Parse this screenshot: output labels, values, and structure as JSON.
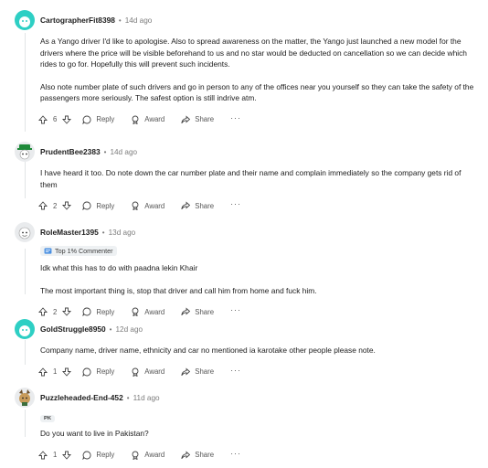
{
  "comments": [
    {
      "author": "CartographerFit8398",
      "time": "14d ago",
      "avatar_color": "#2ecfc4",
      "paragraphs": [
        "As a Yango driver I'd like to apologise. Also to spread awareness on the matter, the Yango just launched a new model for the drivers where the price will be visible beforehand to us and no star would be deducted on cancellation so we can decide which rides to go for. Hopefully this will prevent such incidents.",
        "Also note number plate of such drivers and go in person to any of the offices near you yourself so they can take the safety of the passengers more seriously. The safest option is still indrive atm."
      ],
      "votes": "6"
    },
    {
      "author": "PrudentBee2383",
      "time": "14d ago",
      "avatar_color": "#e9ebed",
      "paragraphs": [
        "I have heard it too. Do note down the car number plate and their name and complain immediately so the company gets rid of them"
      ],
      "votes": "2"
    },
    {
      "author": "RoleMaster1395",
      "time": "13d ago",
      "avatar_color": "#e9ebed",
      "flair": "Top 1% Commenter",
      "paragraphs": [
        "Idk what this has to do with paadna lekin Khair",
        "The most important thing is, stop that driver and call him from home and fuck him."
      ],
      "votes": "2"
    },
    {
      "author": "GoldStruggle8950",
      "time": "12d ago",
      "avatar_color": "#2ecfc4",
      "paragraphs": [
        "Company name, driver name, ethnicity and car no mentioned ia karotake other people please note."
      ],
      "votes": "1"
    },
    {
      "author": "Puzzleheaded-End-452",
      "time": "11d ago",
      "avatar_color": "#e9ebed",
      "flair_pk": "PK",
      "paragraphs": [
        "Do you want to live in Pakistan?"
      ],
      "votes": "1"
    }
  ],
  "actions": {
    "reply": "Reply",
    "award": "Award",
    "share": "Share",
    "more": "···"
  },
  "separator": "•"
}
